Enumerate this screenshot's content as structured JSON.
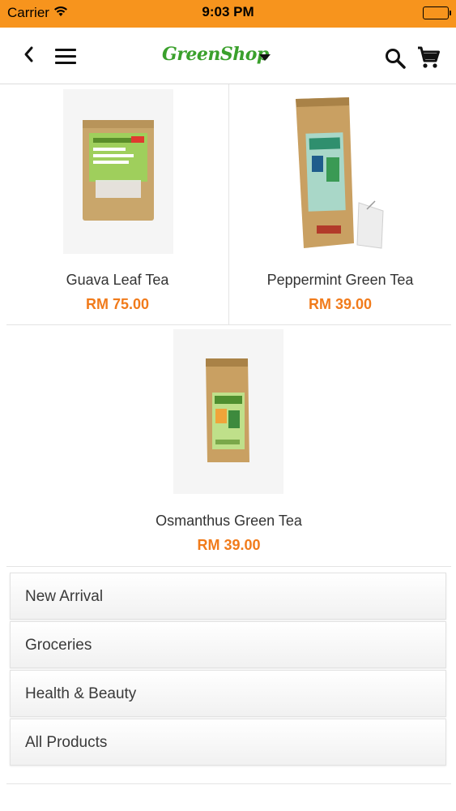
{
  "status_bar": {
    "carrier": "Carrier",
    "time": "9:03 PM"
  },
  "header": {
    "logo": "GreenShop",
    "icons": [
      "back-icon",
      "menu-icon",
      "chevron-down-icon",
      "search-icon",
      "cart-icon"
    ]
  },
  "products": [
    {
      "name": "Guava Leaf Tea",
      "price": "RM 75.00"
    },
    {
      "name": "Peppermint Green Tea",
      "price": "RM 39.00"
    },
    {
      "name": "Osmanthus Green Tea",
      "price": "RM 39.00"
    }
  ],
  "categories": [
    {
      "label": "New Arrival"
    },
    {
      "label": "Groceries"
    },
    {
      "label": "Health & Beauty"
    },
    {
      "label": "All Products"
    }
  ],
  "colors": {
    "status_bar": "#f7941d",
    "price": "#f17b1b",
    "logo": "#3aa02c"
  }
}
